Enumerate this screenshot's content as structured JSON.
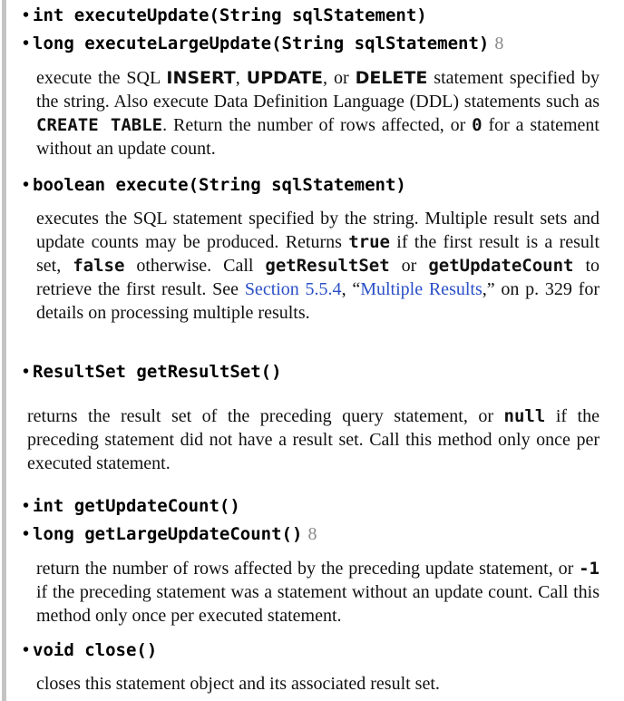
{
  "methods": [
    {
      "sig": "int executeUpdate(String sqlStatement)"
    },
    {
      "sig": "long executeLargeUpdate(String sqlStatement)",
      "since": "8"
    },
    {
      "sig": "boolean execute(String sqlStatement)"
    },
    {
      "sig": "ResultSet getResultSet()"
    },
    {
      "sig": "int getUpdateCount()"
    },
    {
      "sig": "long getLargeUpdateCount()",
      "since": "8"
    },
    {
      "sig": "void close()"
    }
  ],
  "desc_update": {
    "t1": "execute the SQL ",
    "c1": "INSERT",
    "t2": ", ",
    "c2": "UPDATE",
    "t3": ", or ",
    "c3": "DELETE",
    "t4": " statement specified by the string. Also execute Data Definition Language (DDL) statements such as ",
    "c4": "CREATE TABLE",
    "t5": ". Return the number of rows affected, or ",
    "c5": "0",
    "t6": " for a statement without an update count."
  },
  "desc_execute": {
    "t1": "executes the SQL statement specified by the string. Multiple result sets and update counts may be produced. Returns ",
    "c1": "true",
    "t2": " if the first result is a result set, ",
    "c2": "false",
    "t3": " otherwise. Call ",
    "c3": "getResultSet",
    "t4": " or ",
    "c4": "getUpdateCount",
    "t5": " to retrieve the first result. See ",
    "link1": "Section 5.5.4",
    "t6": ", “",
    "link2": "Multiple Results",
    "t7": ",” on p. 329 for details on processing multiple results."
  },
  "desc_resultset": {
    "t1": "returns the result set of the preceding query statement, or ",
    "c1": "null",
    "t2": " if the preceding statement did not have a result set. Call this method only once per executed statement."
  },
  "desc_count": {
    "t1": "return the number of rows affected by the preceding update statement, or ",
    "c1": "-1",
    "t2": " if the preceding statement was a statement without an update count. Call this method only once per executed statement."
  },
  "desc_close": {
    "t1": "closes this statement object and its associated result set."
  }
}
